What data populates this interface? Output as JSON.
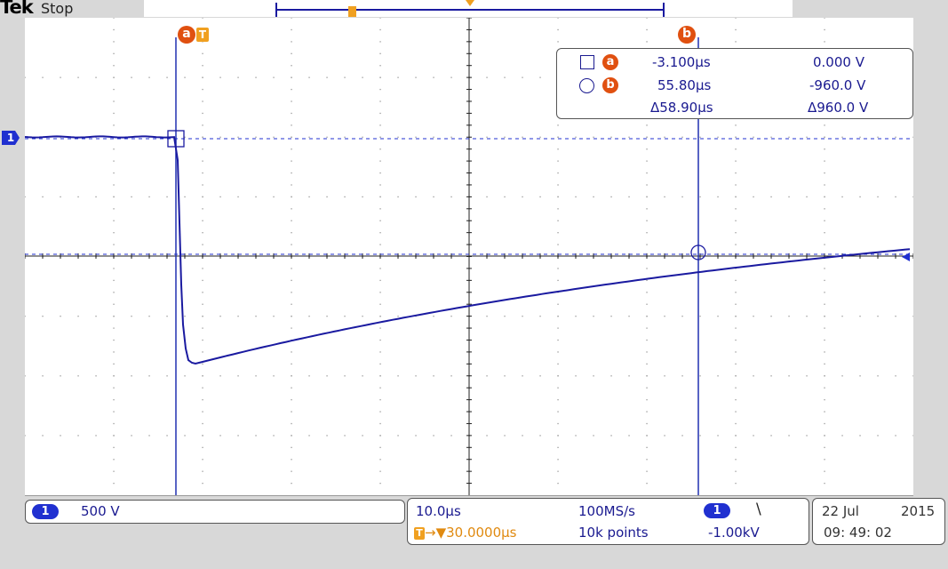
{
  "header": {
    "logo": "Tek",
    "status": "Stop",
    "trigger_marker": "T"
  },
  "cursors": {
    "a_label": "a",
    "b_label": "b",
    "trigger_label": "T"
  },
  "channel_marker": "1",
  "readout": {
    "a": {
      "label": "a",
      "time": "-3.100µs",
      "voltage": "0.000 V"
    },
    "b": {
      "label": "b",
      "time": "55.80µs",
      "voltage": "-960.0 V"
    },
    "delta": {
      "time": "Δ58.90µs",
      "voltage": "Δ960.0 V"
    }
  },
  "channel_panel": {
    "channel": "1",
    "scale": "500 V"
  },
  "timebase_panel": {
    "horizontal_scale": "10.0µs",
    "sample_rate": "100MS/s",
    "trigger_icon": "T",
    "trigger_position": "→▼30.0000µs",
    "record_length": "10k points",
    "trigger_channel": "1",
    "trigger_slope": "\\",
    "trigger_level": "-1.00kV"
  },
  "date_panel": {
    "date_day_month": "22 Jul",
    "year": "2015",
    "time": "09: 49: 02"
  },
  "colors": {
    "trace": "#1a1aa0",
    "cursor_badge": "#e05010",
    "trigger": "#f0a020",
    "channel": "#2030d0"
  },
  "icons": [
    "falling-edge-icon",
    "square-cursor-icon",
    "circle-cursor-icon",
    "trigger-icon",
    "channel-ground-icon"
  ]
}
